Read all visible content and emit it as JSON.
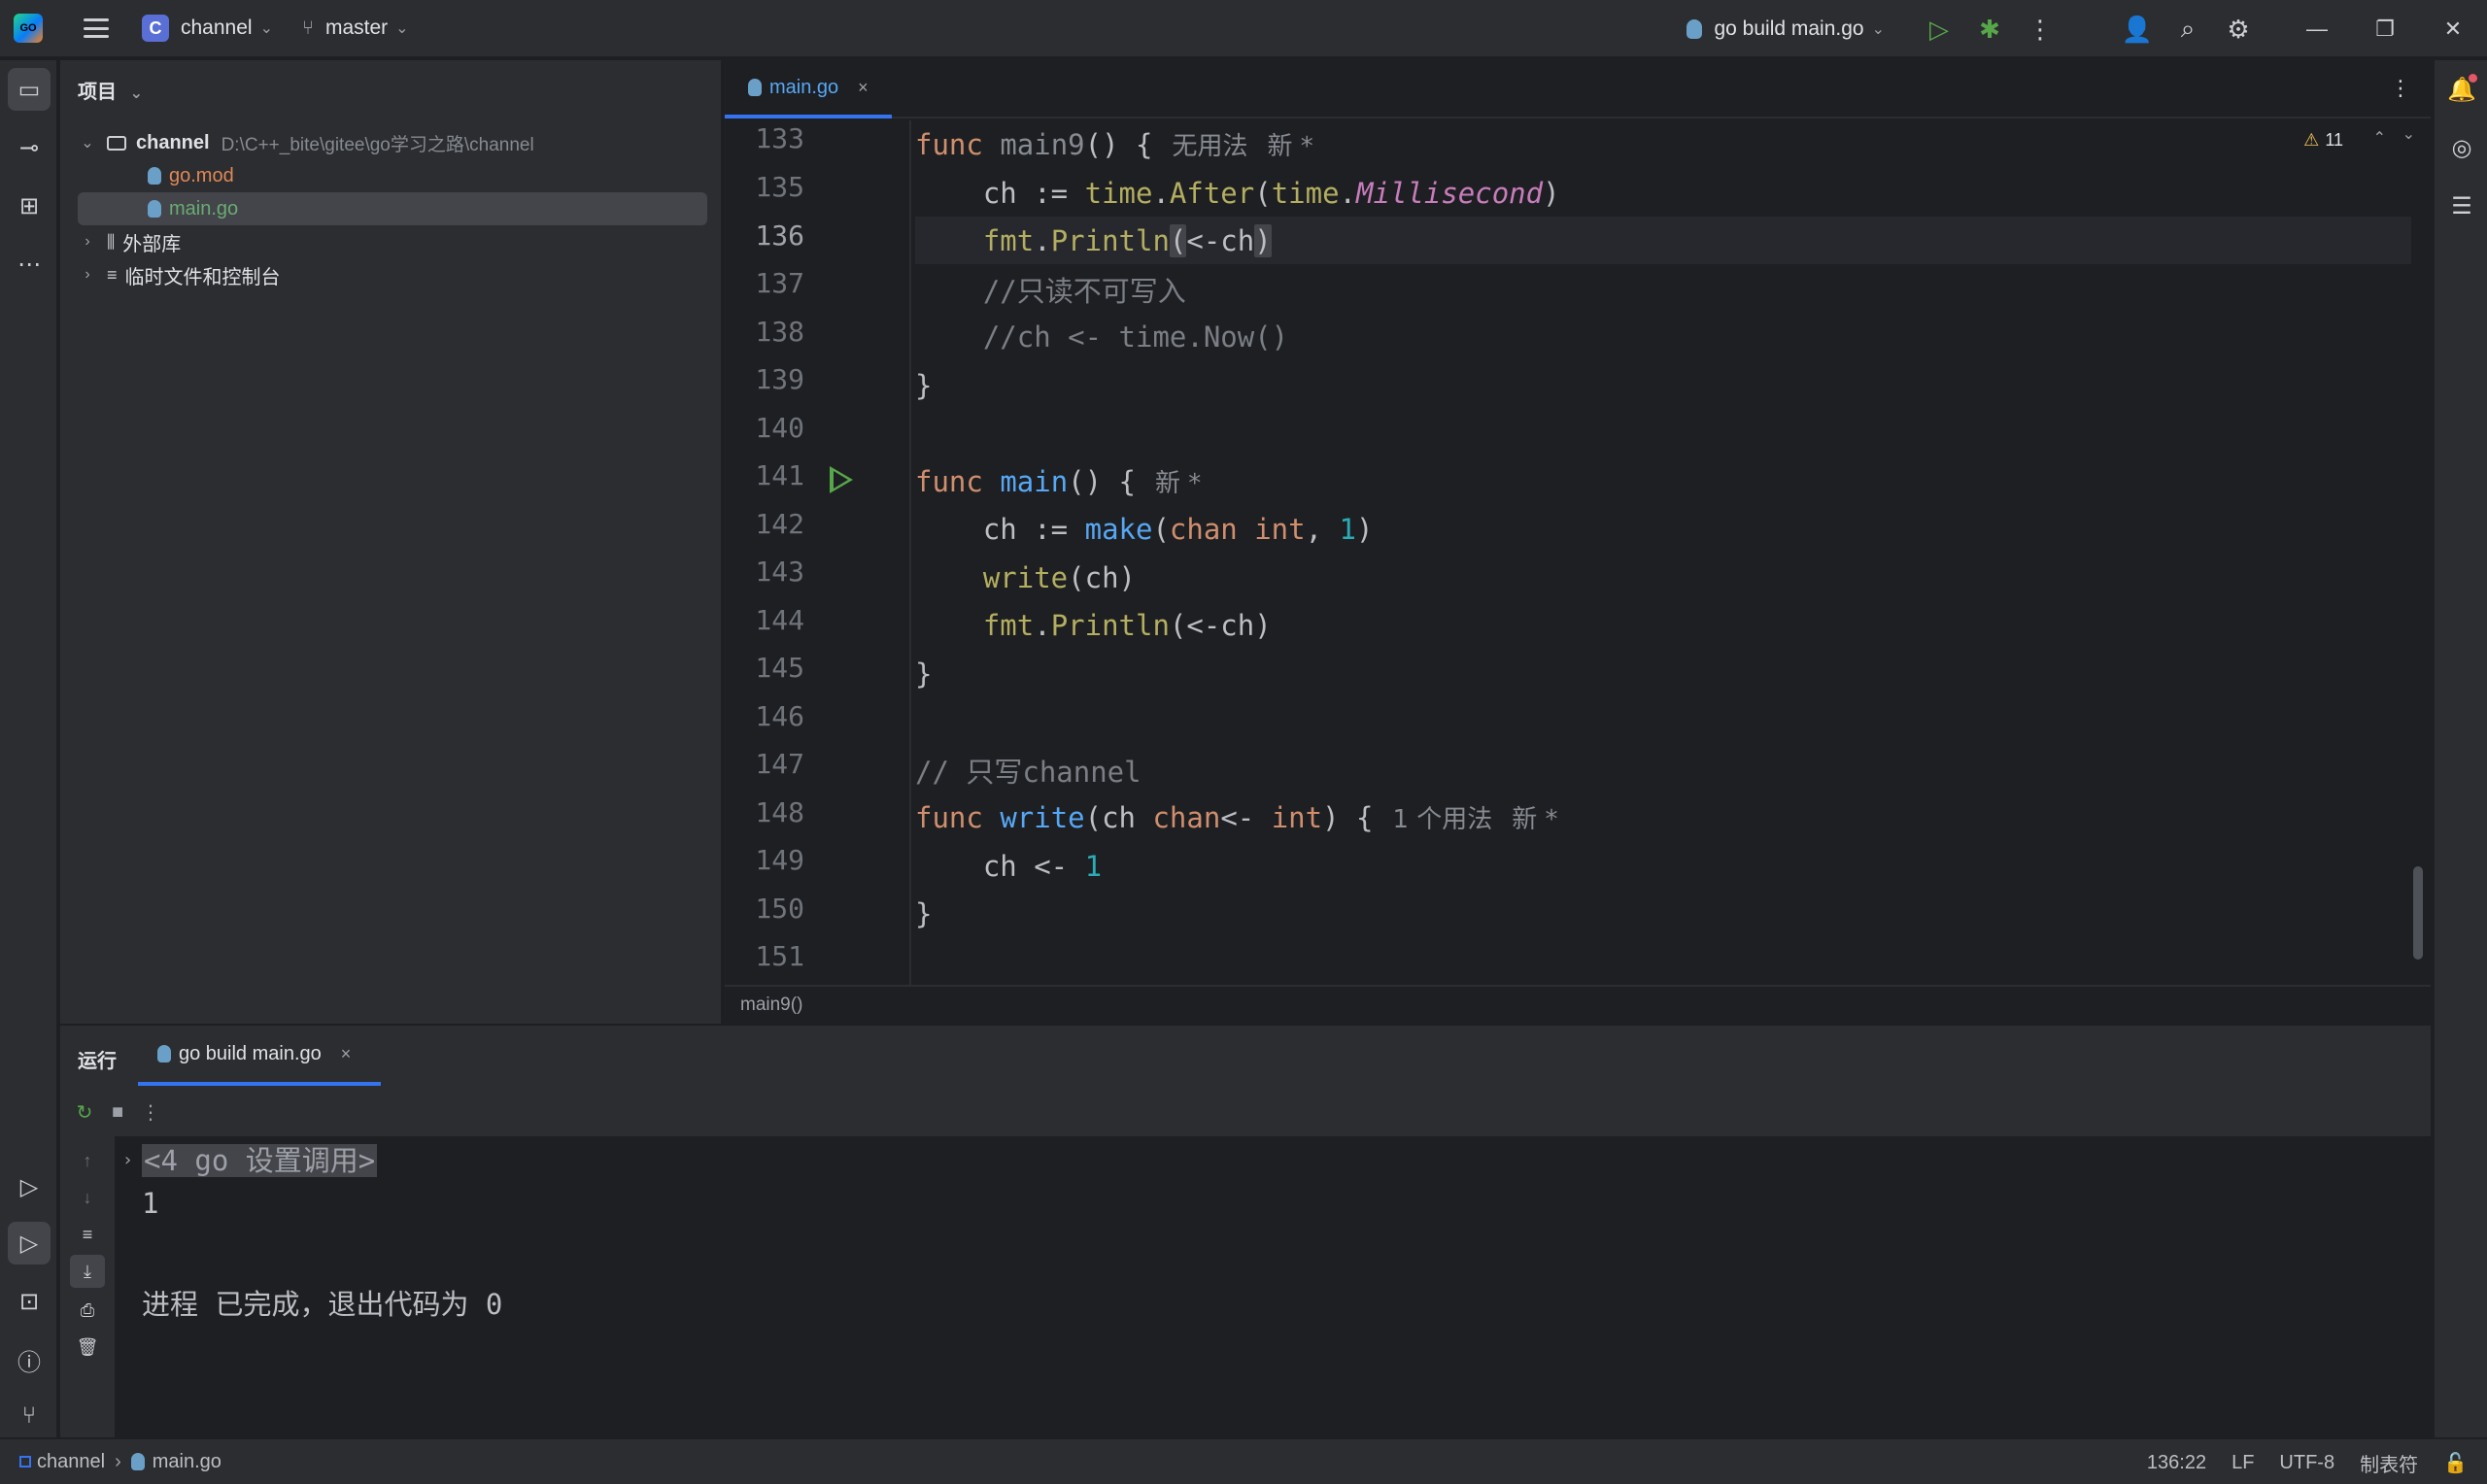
{
  "titlebar": {
    "project_badge": "C",
    "project_name": "channel",
    "branch": "master",
    "run_config": "go build main.go"
  },
  "project_panel": {
    "title": "项目",
    "root": {
      "name": "channel",
      "path": "D:\\C++_bite\\gitee\\go学习之路\\channel"
    },
    "files": [
      {
        "name": "go.mod",
        "color": "#e08855"
      },
      {
        "name": "main.go",
        "color": "#6aab73"
      }
    ],
    "external_libs": "外部库",
    "scratches": "临时文件和控制台"
  },
  "editor": {
    "tab": "main.go",
    "warnings": "11",
    "breadcrumb": "main9()",
    "line_numbers": [
      "133",
      "135",
      "136",
      "137",
      "138",
      "139",
      "140",
      "141",
      "142",
      "143",
      "144",
      "145",
      "146",
      "147",
      "148",
      "149",
      "150",
      "151"
    ],
    "hints": {
      "main9_usage": "无用法",
      "new": "新 *",
      "write_usage": "1 个用法"
    },
    "comments": {
      "c137": "//只读不可写入",
      "c138": "//ch <- time.Now()",
      "c147": "// 只写channel"
    }
  },
  "run_panel": {
    "title": "运行",
    "tab": "go build main.go",
    "console": {
      "folded": "<4 go 设置调用>",
      "output": "1",
      "exit": "进程 已完成，退出代码为 0"
    }
  },
  "statusbar": {
    "project": "channel",
    "file": "main.go",
    "position": "136:22",
    "line_sep": "LF",
    "encoding": "UTF-8",
    "indent": "制表符"
  },
  "colors": {
    "accent": "#3574f0",
    "run_green": "#57a64a",
    "keyword": "#cf8e6d",
    "function": "#56a8f5"
  }
}
